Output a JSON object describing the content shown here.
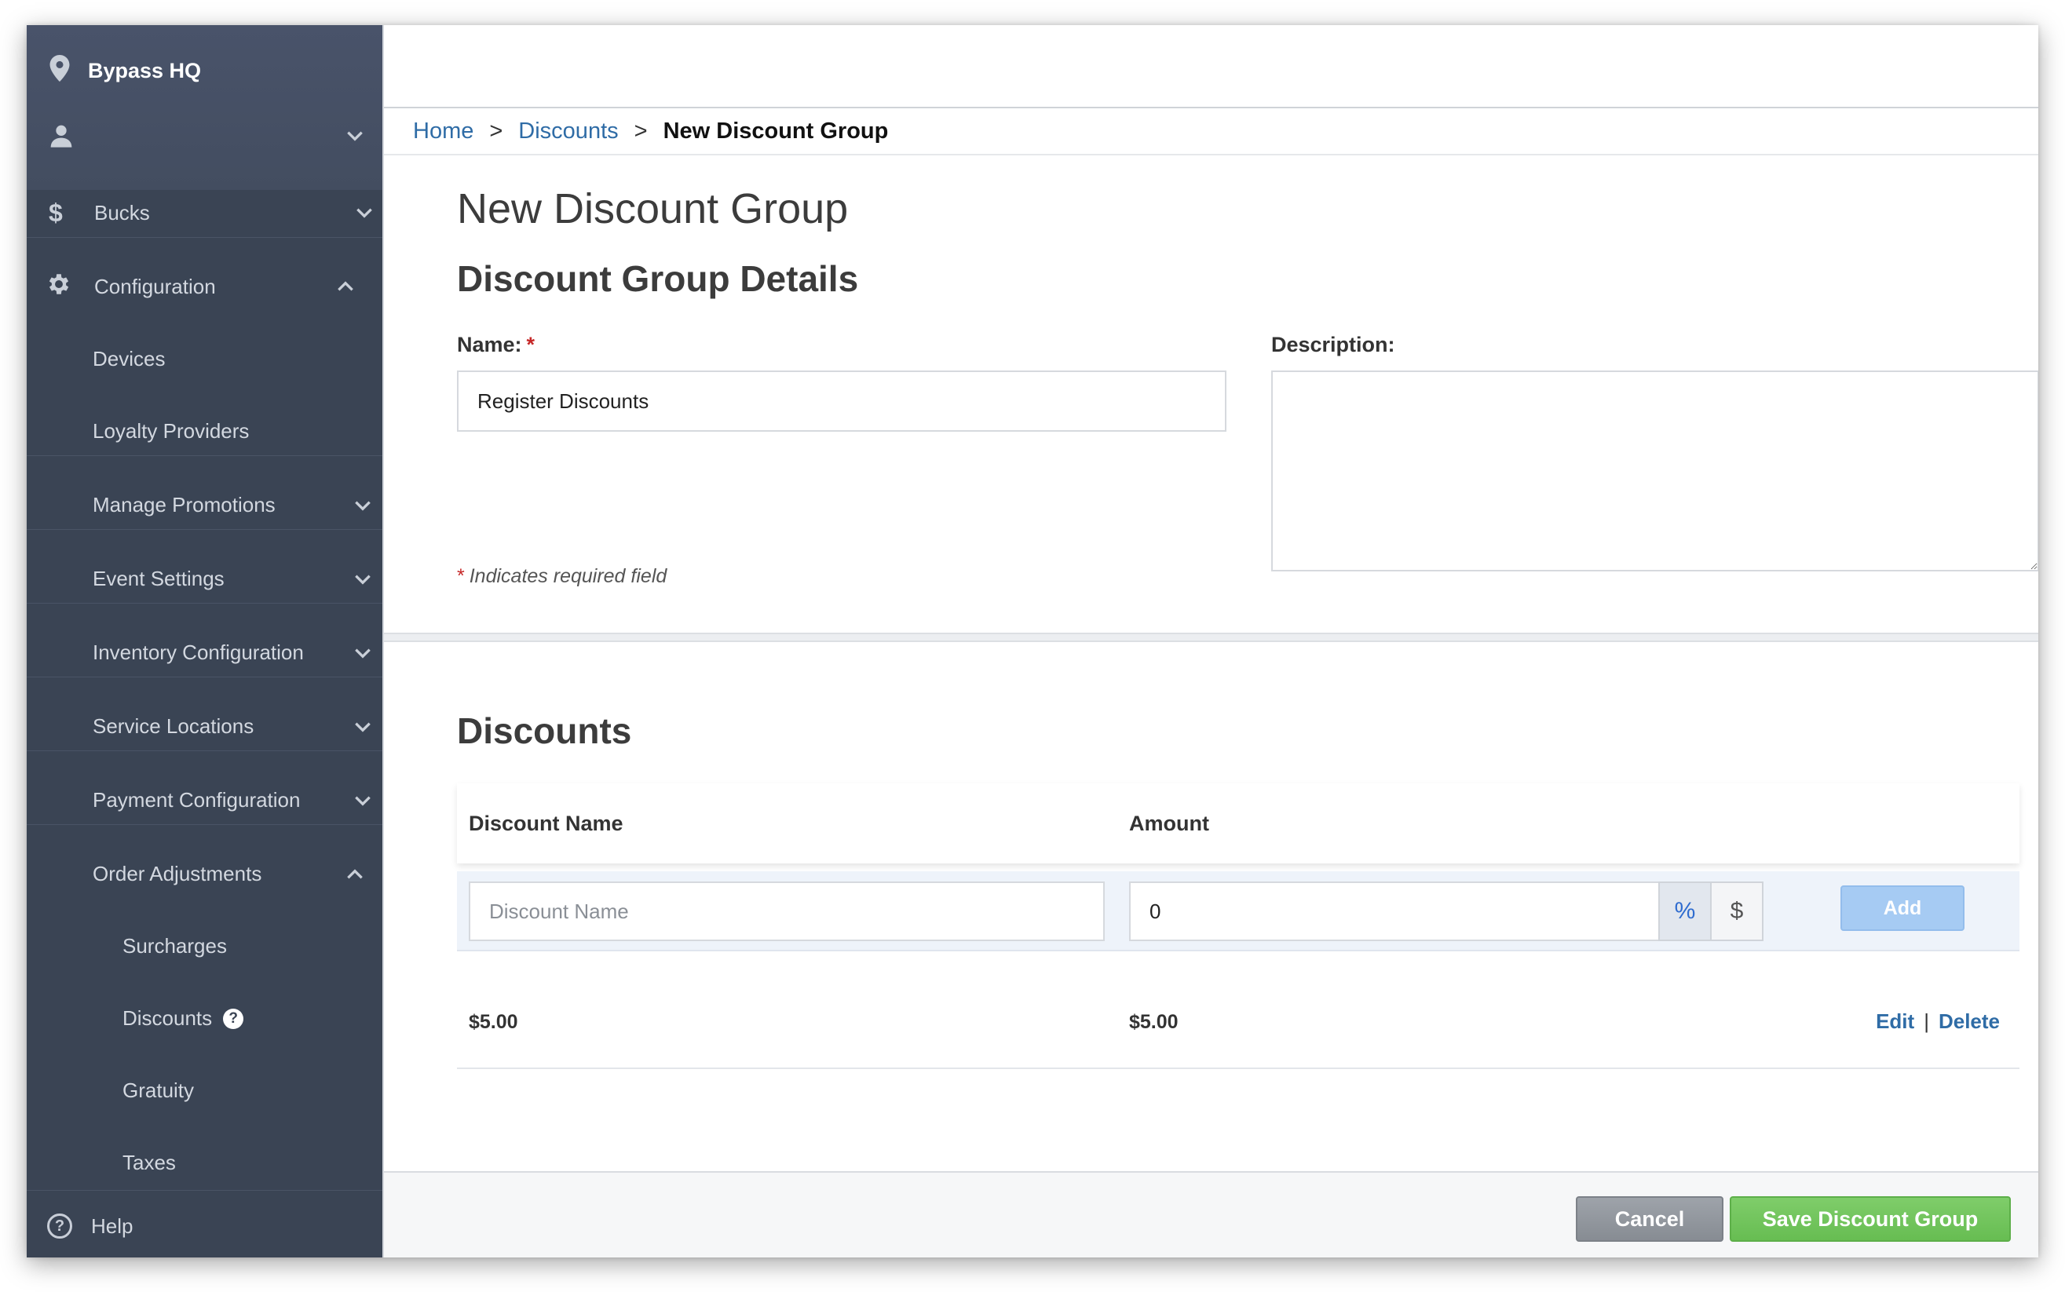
{
  "sidebar": {
    "location": "Bypass HQ",
    "items": {
      "bucks": "Bucks",
      "configuration": "Configuration",
      "devices": "Devices",
      "loyalty": "Loyalty Providers",
      "promotions": "Manage Promotions",
      "events": "Event Settings",
      "inventory": "Inventory Configuration",
      "service": "Service Locations",
      "payment": "Payment Configuration",
      "order_adj": "Order Adjustments",
      "surcharges": "Surcharges",
      "discounts": "Discounts",
      "gratuity": "Gratuity",
      "taxes": "Taxes",
      "help": "Help"
    },
    "help_badge": "?"
  },
  "breadcrumb": {
    "home": "Home",
    "sep": ">",
    "discounts": "Discounts",
    "current": "New Discount Group"
  },
  "page": {
    "title": "New Discount Group",
    "details_title": "Discount Group Details",
    "name_label": "Name:",
    "required_mark": "*",
    "name_value": "Register Discounts",
    "description_label": "Description:",
    "description_value": "",
    "required_note": "Indicates required field"
  },
  "discounts": {
    "title": "Discounts",
    "col_name": "Discount Name",
    "col_amount": "Amount",
    "name_placeholder": "Discount Name",
    "amount_value": "0",
    "unit_percent": "%",
    "unit_dollar": "$",
    "add_label": "Add",
    "rows": [
      {
        "name": "$5.00",
        "amount": "$5.00",
        "edit": "Edit",
        "delete": "Delete",
        "pipe": "|"
      }
    ]
  },
  "footer": {
    "cancel": "Cancel",
    "save": "Save Discount Group"
  },
  "colors": {
    "sidebar_bg": "#3a4454",
    "link": "#2f6ca6",
    "save_green": "#67bd52",
    "add_blue": "#a6cbf3",
    "required_red": "#c62828"
  }
}
